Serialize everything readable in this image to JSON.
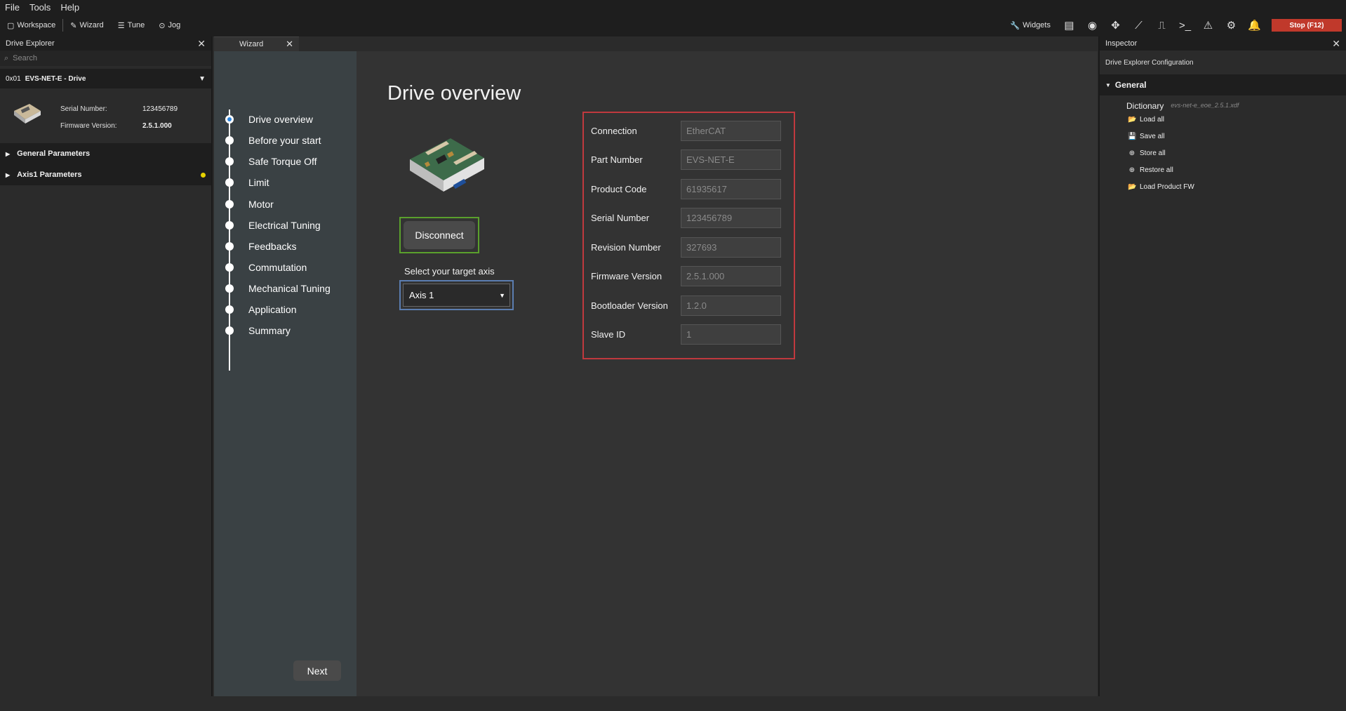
{
  "menu": [
    "File",
    "Tools",
    "Help"
  ],
  "toolbar": {
    "left": [
      {
        "icon": "workspace-icon",
        "glyph": "▢",
        "label": "Workspace"
      },
      {
        "icon": "wizard-icon",
        "glyph": "✎",
        "label": "Wizard"
      },
      {
        "icon": "tune-icon",
        "glyph": "☰",
        "label": "Tune"
      },
      {
        "icon": "jog-icon",
        "glyph": "⊙",
        "label": "Jog"
      }
    ],
    "widgets_label": "Widgets",
    "right_icons": [
      "list-icon",
      "eye-icon",
      "move-icon",
      "chart-icon",
      "signal-icon",
      "terminal-icon",
      "warning-icon",
      "gear-icon",
      "bell-icon"
    ],
    "stop_label": "Stop (F12)"
  },
  "drive_explorer": {
    "title": "Drive Explorer",
    "search_placeholder": "Search",
    "drive": {
      "address": "0x01",
      "name": "EVS-NET-E - Drive"
    },
    "serial_label": "Serial Number:",
    "serial_value": "123456789",
    "firmware_label": "Firmware Version:",
    "firmware_value": "2.5.1.000",
    "tree": [
      {
        "label": "General Parameters",
        "indicator": false
      },
      {
        "label": "Axis1 Parameters",
        "indicator": true,
        "indicator_color": "#e6d200"
      }
    ]
  },
  "wizard": {
    "tab_label": "Wizard",
    "steps": [
      "Drive overview",
      "Before your start",
      "Safe Torque Off",
      "Limit",
      "Motor",
      "Electrical Tuning",
      "Feedbacks",
      "Commutation",
      "Mechanical Tuning",
      "Application",
      "Summary"
    ],
    "active_step": 0,
    "next_label": "Next",
    "page_title": "Drive overview",
    "disconnect_label": "Disconnect",
    "axis_prompt": "Select your target axis",
    "axis_selected": "Axis 1",
    "info": [
      {
        "label": "Connection",
        "value": "EtherCAT"
      },
      {
        "label": "Part Number",
        "value": "EVS-NET-E"
      },
      {
        "label": "Product Code",
        "value": "61935617"
      },
      {
        "label": "Serial Number",
        "value": "123456789"
      },
      {
        "label": "Revision Number",
        "value": "327693"
      },
      {
        "label": "Firmware Version",
        "value": "2.5.1.000"
      },
      {
        "label": "Bootloader Version",
        "value": "1.2.0"
      },
      {
        "label": "Slave ID",
        "value": "1"
      }
    ]
  },
  "inspector": {
    "title": "Inspector",
    "subtitle": "Drive Explorer Configuration",
    "group": "General",
    "dictionary_label": "Dictionary",
    "dictionary_file": "evs-net-e_eoe_2.5.1.xdf",
    "actions": [
      {
        "icon": "folder-open-icon",
        "glyph": "📂",
        "label": "Load all"
      },
      {
        "icon": "save-icon",
        "glyph": "💾",
        "label": "Save all"
      },
      {
        "icon": "plus-circle-icon",
        "glyph": "⊕",
        "label": "Store all"
      },
      {
        "icon": "plus-circle-icon",
        "glyph": "⊕",
        "label": "Restore all"
      },
      {
        "icon": "folder-open-icon",
        "glyph": "📂",
        "label": "Load Product FW"
      }
    ]
  },
  "colors": {
    "stop": "#c0392b",
    "disconnect_outline": "#5aa02c",
    "axis_outline": "#5b7db0",
    "info_outline": "#c0393e",
    "active_step": "#2e86de"
  }
}
